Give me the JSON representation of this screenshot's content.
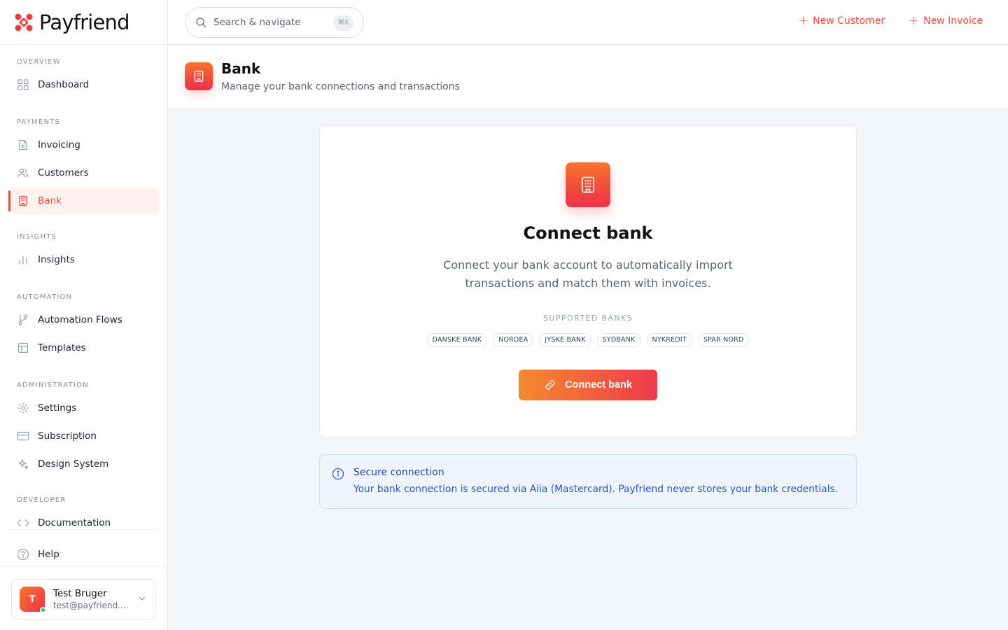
{
  "brand": {
    "name": "Payfriend"
  },
  "sidebar": {
    "sections": {
      "overview": "OVERVIEW",
      "payments": "PAYMENTS",
      "insights": "INSIGHTS",
      "automation": "AUTOMATION",
      "administration": "ADMINISTRATION",
      "developer": "DEVELOPER"
    },
    "items": {
      "dashboard": "Dashboard",
      "invoicing": "Invoicing",
      "customers": "Customers",
      "bank": "Bank",
      "insights": "Insights",
      "automation_flows": "Automation Flows",
      "templates": "Templates",
      "settings": "Settings",
      "subscription": "Subscription",
      "design_system": "Design System",
      "documentation": "Documentation"
    },
    "active_item": "bank",
    "help": "Help",
    "user": {
      "initial": "T",
      "name": "Test Bruger",
      "email": "test@payfriend.t..."
    }
  },
  "topbar": {
    "search_placeholder": "Search & navigate",
    "shortcut": "⌘K",
    "new_customer": "New Customer",
    "new_invoice": "New Invoice"
  },
  "header": {
    "title": "Bank",
    "subtitle": "Manage your bank connections and transactions"
  },
  "connect_card": {
    "title": "Connect bank",
    "description": "Connect your bank account to automatically import transactions and match them with invoices.",
    "supported_label": "SUPPORTED BANKS",
    "banks": [
      "DANSKE BANK",
      "NORDEA",
      "JYSKE BANK",
      "SYDBANK",
      "NYKREDIT",
      "SPAR NORD"
    ],
    "button": "Connect bank"
  },
  "info_box": {
    "title": "Secure connection",
    "text": "Your bank connection is secured via Aiia (Mastercard). Payfriend never stores your bank credentials."
  },
  "colors": {
    "accent": "#ef4a34",
    "gradient_start": "#f7742c",
    "gradient_end": "#ee2f4a",
    "info_bg": "#eef5fd",
    "info_text": "#2a53c4"
  }
}
